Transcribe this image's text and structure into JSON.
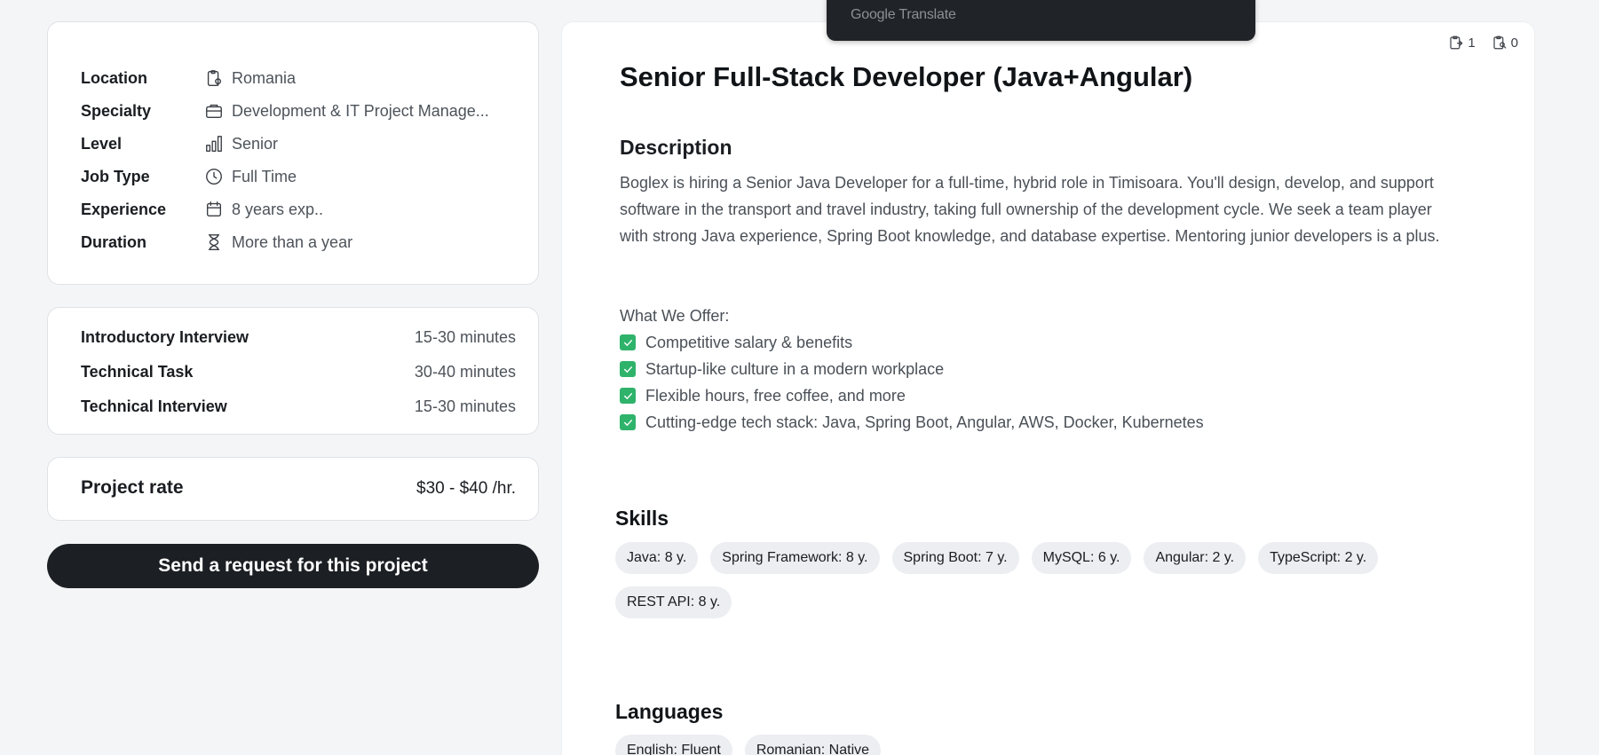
{
  "info": {
    "rows": [
      {
        "label": "Location",
        "icon": "clipboard-pin-icon",
        "value": "Romania"
      },
      {
        "label": "Specialty",
        "icon": "briefcase-icon",
        "value": "Development & IT Project Manage..."
      },
      {
        "label": "Level",
        "icon": "bar-chart-icon",
        "value": "Senior"
      },
      {
        "label": "Job Type",
        "icon": "clock-icon",
        "value": "Full Time"
      },
      {
        "label": "Experience",
        "icon": "calendar-icon",
        "value": "8 years exp.."
      },
      {
        "label": "Duration",
        "icon": "hourglass-icon",
        "value": "More than a year"
      }
    ]
  },
  "steps": [
    {
      "label": "Introductory Interview",
      "duration": "15-30 minutes"
    },
    {
      "label": "Technical Task",
      "duration": "30-40 minutes"
    },
    {
      "label": "Technical Interview",
      "duration": "15-30 minutes"
    }
  ],
  "rate": {
    "label": "Project rate",
    "value": "$30 - $40 /hr."
  },
  "send_button": "Send a request for this project",
  "translate_popup": {
    "label": "Google Translate"
  },
  "counters": [
    {
      "icon": "clipboard-export-icon",
      "value": "1"
    },
    {
      "icon": "clipboard-search-icon",
      "value": "0"
    }
  ],
  "job": {
    "title": "Senior Full-Stack Developer (Java+Angular)",
    "description_heading": "Description",
    "description": "Boglex is hiring a Senior Java Developer for a full-time, hybrid role in Timisoara. You'll design, develop, and support software in the transport and travel industry, taking full ownership of the development cycle. We seek a team player with strong Java experience, Spring Boot knowledge, and database expertise. Mentoring junior developers is a plus.",
    "offer_heading": "What We Offer:",
    "offers": [
      "Competitive salary & benefits",
      "Startup-like culture in a modern workplace",
      "Flexible hours, free coffee, and more",
      "Cutting-edge tech stack: Java, Spring Boot, Angular, AWS, Docker, Kubernetes"
    ]
  },
  "skills": {
    "heading": "Skills",
    "items": [
      "Java: 8 y.",
      "Spring Framework: 8 y.",
      "Spring Boot: 7 y.",
      "MySQL: 6 y.",
      "Angular: 2 y.",
      "TypeScript: 2 y.",
      "REST API: 8 y."
    ]
  },
  "languages": {
    "heading": "Languages",
    "items": [
      "English: Fluent",
      "Romanian: Native"
    ]
  },
  "colors": {
    "accent_dark": "#1c1f23",
    "check_green": "#2fb36b",
    "chip_bg": "#eceef1"
  }
}
